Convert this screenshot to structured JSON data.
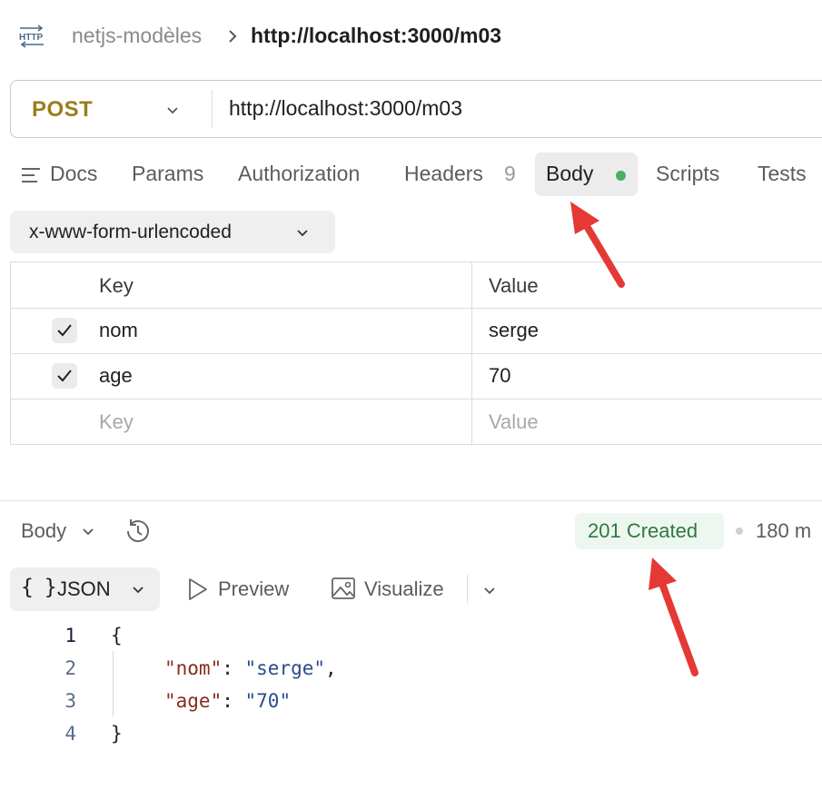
{
  "breadcrumb": {
    "collection": "netjs-modèles",
    "request": "http://localhost:3000/m03"
  },
  "request": {
    "method": "POST",
    "url": "http://localhost:3000/m03"
  },
  "tabs": {
    "docs": "Docs",
    "params": "Params",
    "authorization": "Authorization",
    "headers": "Headers",
    "headers_count": "9",
    "body": "Body",
    "scripts": "Scripts",
    "tests": "Tests"
  },
  "body_type": "x-www-form-urlencoded",
  "params_table": {
    "headers": [
      "Key",
      "Value"
    ],
    "rows": [
      {
        "checked": true,
        "key": "nom",
        "value": "serge"
      },
      {
        "checked": true,
        "key": "age",
        "value": "70"
      }
    ],
    "placeholder": {
      "key": "Key",
      "value": "Value"
    }
  },
  "response": {
    "body_label": "Body",
    "status": "201 Created",
    "time": "180 m",
    "view_tabs": {
      "json_braces": "{ }",
      "json": "JSON",
      "preview": "Preview",
      "visualize": "Visualize"
    },
    "line_numbers": [
      "1",
      "2",
      "3",
      "4"
    ],
    "code": {
      "open": "{",
      "line2_key": "\"nom\"",
      "line2_colon": ": ",
      "line2_value": "\"serge\"",
      "line2_comma": ",",
      "line3_key": "\"age\"",
      "line3_colon": ": ",
      "line3_value": "\"70\"",
      "close": "}"
    }
  },
  "colors": {
    "method": "#9b7d1e",
    "status_text": "#2d7a3e",
    "status_bg": "#eef7ef",
    "body_dot": "#4caf63",
    "json_key": "#8a2b1c",
    "json_string": "#2a4b8d",
    "annotation_arrow": "#e53935"
  },
  "icons": [
    "http-icon",
    "chevron-right-icon",
    "chevron-down-icon",
    "docs-icon",
    "check-icon",
    "history-icon",
    "preview-play-icon",
    "visualize-image-icon"
  ]
}
